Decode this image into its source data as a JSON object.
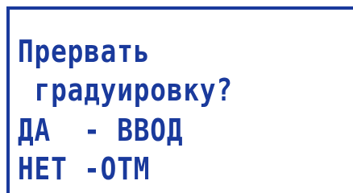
{
  "display": {
    "lines": [
      "Прервать",
      " градуировку?",
      "ДА  - ВВОД",
      "НЕТ -ОТМ"
    ]
  },
  "colors": {
    "text": "#1a3a9c",
    "border": "#1a3a9c",
    "background": "#ffffff"
  }
}
